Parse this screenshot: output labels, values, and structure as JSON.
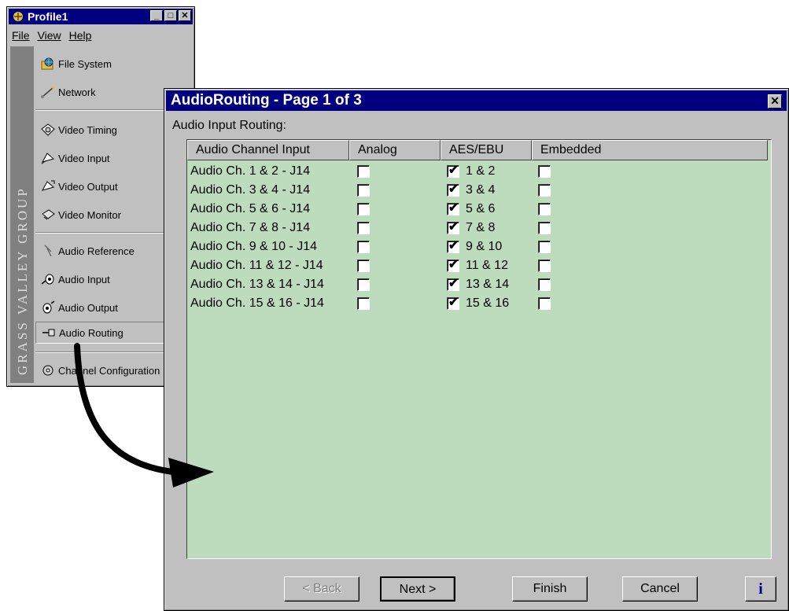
{
  "profile_window": {
    "title": "Profile1",
    "menu": [
      "File",
      "View",
      "Help"
    ],
    "sidebar_brand": "GRASS VALLEY GROUP",
    "nav_items": [
      {
        "label": "File System",
        "icon": "globe-folder-icon"
      },
      {
        "label": "Network",
        "icon": "network-icon"
      },
      {
        "label": "Video Timing",
        "icon": "video-timing-icon"
      },
      {
        "label": "Video Input",
        "icon": "video-input-icon"
      },
      {
        "label": "Video Output",
        "icon": "video-output-icon"
      },
      {
        "label": "Video Monitor",
        "icon": "video-monitor-icon"
      },
      {
        "label": "Audio Reference",
        "icon": "audio-reference-icon"
      },
      {
        "label": "Audio Input",
        "icon": "audio-input-icon"
      },
      {
        "label": "Audio Output",
        "icon": "audio-output-icon"
      },
      {
        "label": "Audio Routing",
        "icon": "audio-routing-icon",
        "selected": true
      },
      {
        "label": "Channel Configuration",
        "icon": "channel-configuration-icon"
      }
    ]
  },
  "dialog": {
    "title": "AudioRouting - Page 1 of 3",
    "group_label": "Audio Input Routing:",
    "columns": [
      "Audio Channel Input",
      "Analog",
      "AES/EBU",
      "Embedded"
    ],
    "rows": [
      {
        "channel": "Audio Ch. 1 & 2 - J14",
        "analog": false,
        "aes": true,
        "aes_label": "1 & 2",
        "embedded": false
      },
      {
        "channel": "Audio Ch. 3 & 4 - J14",
        "analog": false,
        "aes": true,
        "aes_label": "3 & 4",
        "embedded": false
      },
      {
        "channel": "Audio Ch. 5 & 6 - J14",
        "analog": false,
        "aes": true,
        "aes_label": "5 & 6",
        "embedded": false
      },
      {
        "channel": "Audio Ch. 7 & 8 - J14",
        "analog": false,
        "aes": true,
        "aes_label": "7 & 8",
        "embedded": false
      },
      {
        "channel": "Audio Ch. 9 & 10 - J14",
        "analog": false,
        "aes": true,
        "aes_label": "9 & 10",
        "embedded": false
      },
      {
        "channel": "Audio Ch. 11 & 12 - J14",
        "analog": false,
        "aes": true,
        "aes_label": "11 & 12",
        "embedded": false
      },
      {
        "channel": "Audio Ch. 13 & 14 - J14",
        "analog": false,
        "aes": true,
        "aes_label": "13 & 14",
        "embedded": false
      },
      {
        "channel": "Audio Ch. 15 & 16 - J14",
        "analog": false,
        "aes": true,
        "aes_label": "15 & 16",
        "embedded": false
      }
    ],
    "buttons": {
      "back": "< Back",
      "next": "Next >",
      "finish": "Finish",
      "cancel": "Cancel",
      "info": "i"
    }
  },
  "colors": {
    "titlebar": "#000080",
    "list_background": "#bddbbd",
    "window_face": "#c0c0c0"
  }
}
